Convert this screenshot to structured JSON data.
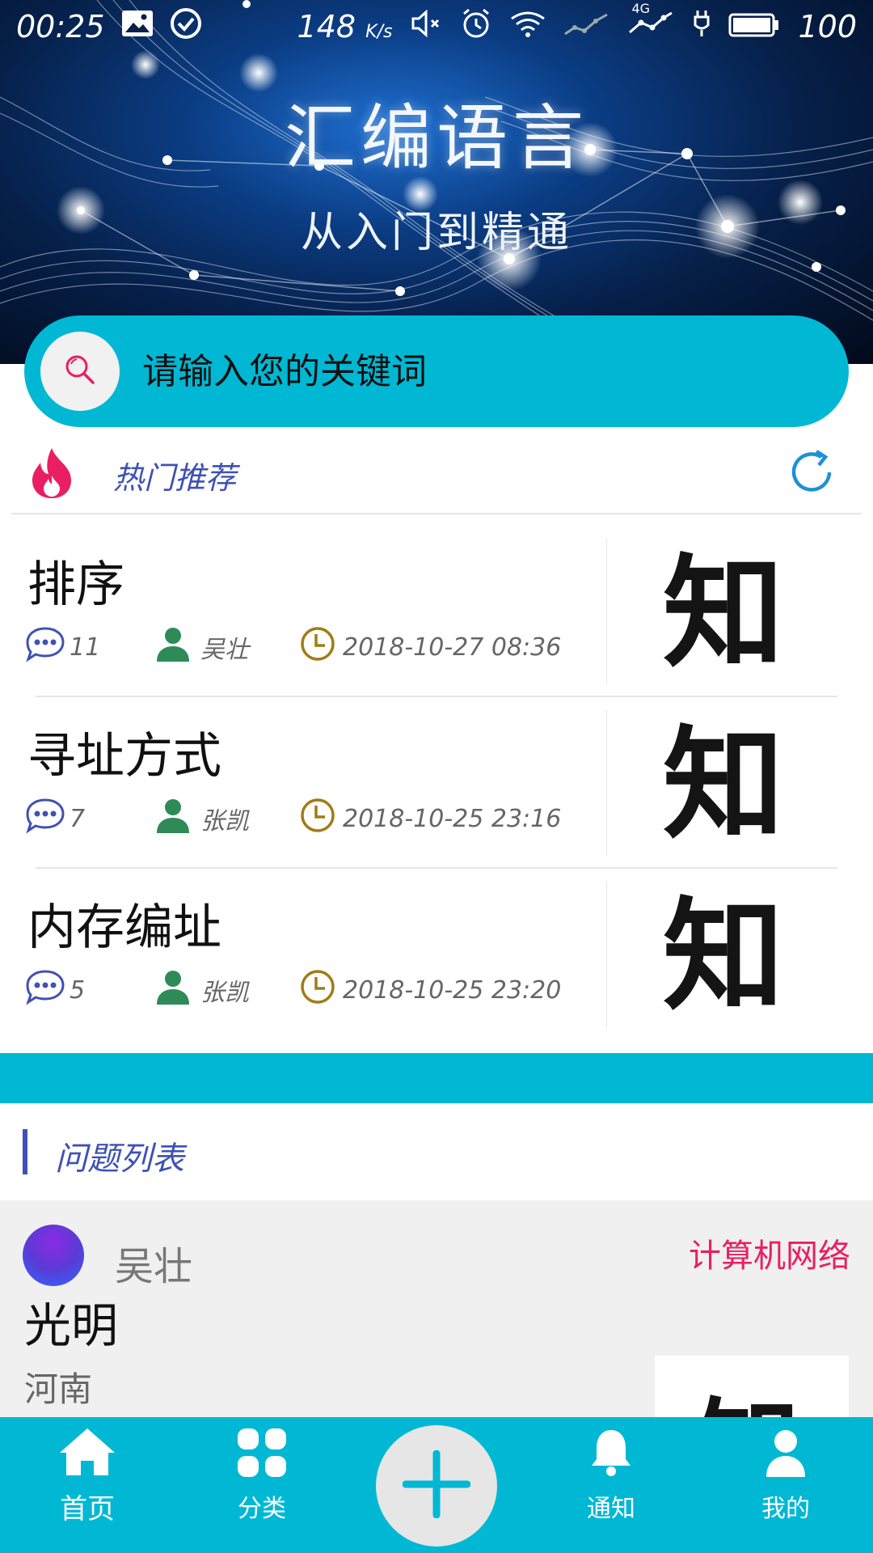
{
  "status_bar": {
    "time": "00:25",
    "speed": "148",
    "speed_unit": "K/s",
    "network": "4G",
    "battery": "100",
    "icons": [
      "image-icon",
      "check-circle-icon",
      "mute-icon",
      "alarm-icon",
      "wifi-icon",
      "signal-icon",
      "charging-icon",
      "battery-icon"
    ]
  },
  "banner": {
    "title": "汇编语言",
    "subtitle": "从入门到精通"
  },
  "search": {
    "placeholder": "请输入您的关键词"
  },
  "hot": {
    "title": "热门推荐",
    "items": [
      {
        "title": "排序",
        "comments": "11",
        "author": "吴壮",
        "time": "2018-10-27 08:36",
        "thumb": "知"
      },
      {
        "title": "寻址方式",
        "comments": "7",
        "author": "张凯",
        "time": "2018-10-25 23:16",
        "thumb": "知"
      },
      {
        "title": "内存编址",
        "comments": "5",
        "author": "张凯",
        "time": "2018-10-25 23:20",
        "thumb": "知"
      }
    ]
  },
  "questions": {
    "title": "问题列表",
    "first": {
      "author": "吴壮",
      "category": "计算机网络",
      "title": "光明",
      "location": "河南",
      "thumb": "知"
    }
  },
  "nav": {
    "home": "首页",
    "category": "分类",
    "notify": "通知",
    "mine": "我的"
  },
  "colors": {
    "accent": "#00b8d4",
    "title_blue": "#3f51b5",
    "category_pink": "#e91e63",
    "fire": "#e91e63",
    "clock": "#a07c14",
    "author_green": "#2e8b57"
  }
}
